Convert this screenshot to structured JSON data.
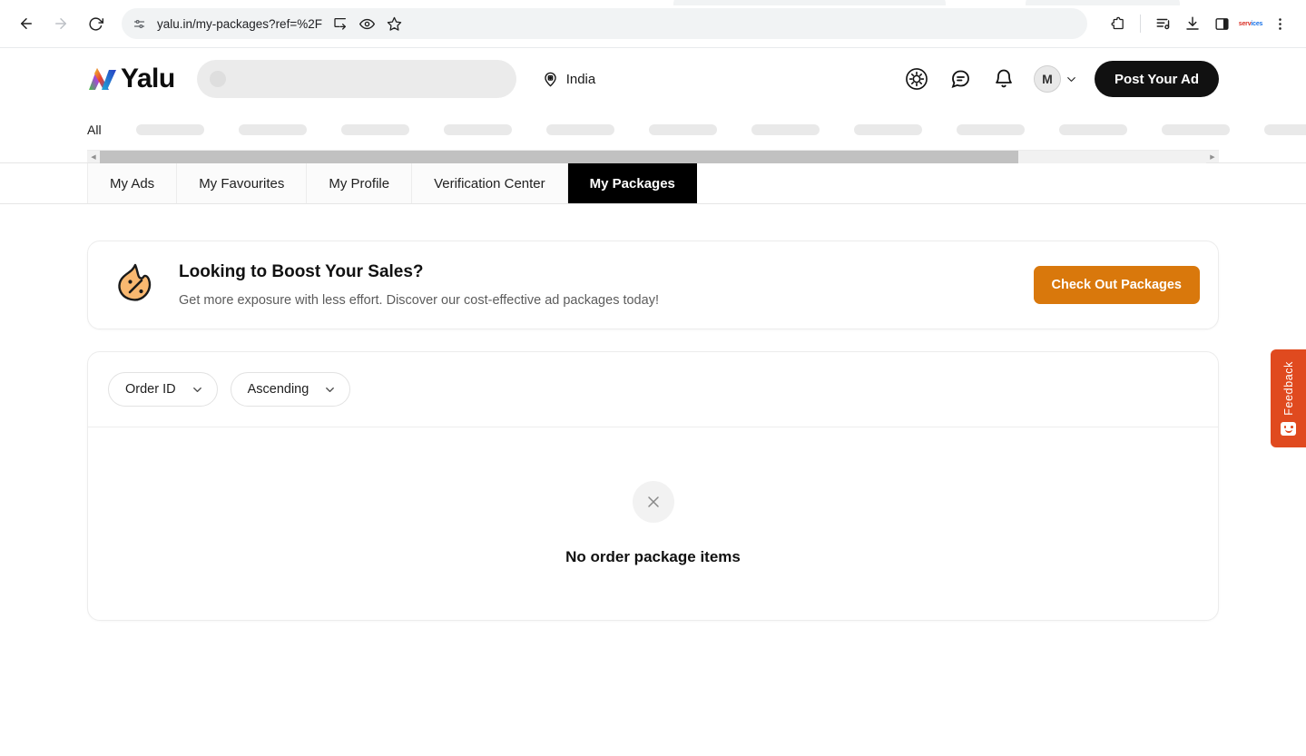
{
  "browser": {
    "url": "yalu.in/my-packages?ref=%2F",
    "back_label": "Back",
    "forward_label": "Forward",
    "reload_label": "Reload",
    "site_info_label": "View site information",
    "install_label": "Install page as app",
    "view_label": "Page view",
    "bookmark_label": "Bookmark this tab",
    "extensions_label": "Extensions",
    "playlist_label": "Media playlist",
    "downloads_label": "Downloads",
    "sidepanel_label": "Side panel",
    "ext_red_line1": "serv",
    "ext_red_line2": "ices",
    "menu_label": "Customize and control Chrome"
  },
  "header": {
    "brand": "Yalu",
    "search_placeholder": "",
    "location": "India",
    "theme_label": "Theme",
    "chat_label": "Messages",
    "bell_label": "Notifications",
    "avatar_initial": "M",
    "post_ad_label": "Post Your Ad"
  },
  "category_nav": {
    "all_label": "All",
    "skeleton_count": 12,
    "scroll_thumb_percent": 83
  },
  "tabs": [
    {
      "label": "My Ads",
      "active": false
    },
    {
      "label": "My Favourites",
      "active": false
    },
    {
      "label": "My Profile",
      "active": false
    },
    {
      "label": "Verification Center",
      "active": false
    },
    {
      "label": "My Packages",
      "active": true
    }
  ],
  "promo": {
    "title": "Looking to Boost Your Sales?",
    "subtitle": "Get more exposure with less effort. Discover our cost-effective ad packages today!",
    "button_label": "Check Out Packages",
    "accent_color": "#d9780c",
    "icon_color": "#f9b870"
  },
  "filters": {
    "sort_field": "Order ID",
    "sort_direction": "Ascending"
  },
  "empty_state": {
    "message": "No order package items"
  },
  "feedback": {
    "label": "Feedback",
    "color": "#e04a1f"
  }
}
